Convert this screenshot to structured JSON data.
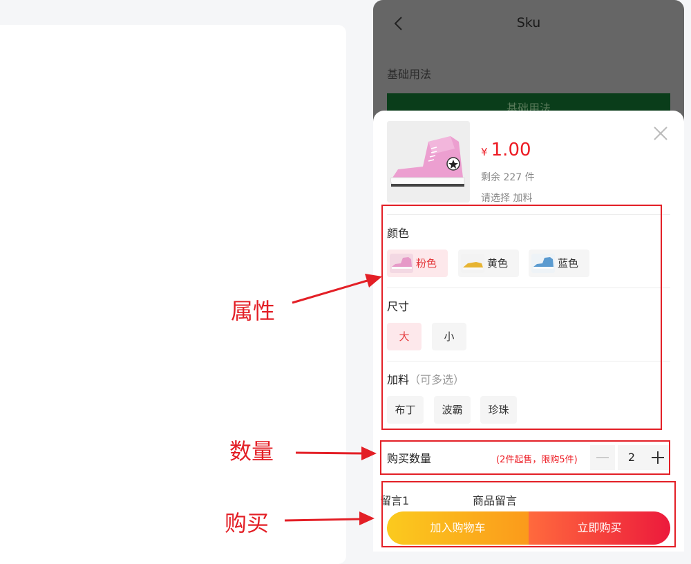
{
  "nav": {
    "title": "Sku"
  },
  "section": {
    "label": "基础用法",
    "button_label": "基础用法"
  },
  "product": {
    "currency": "¥",
    "price": "1.00",
    "stock": "剩余 227 件",
    "hint": "请选择 加料",
    "colors": {
      "shoe_main": "#ec9fd0",
      "accent": "#ed1c24"
    }
  },
  "groups": [
    {
      "title": "颜色",
      "subtitle": "",
      "options": [
        {
          "label": "粉色",
          "selected": true,
          "thumb_color": "#e69ac8"
        },
        {
          "label": "黄色",
          "selected": false,
          "thumb_color": "#e7b432"
        },
        {
          "label": "蓝色",
          "selected": false,
          "thumb_color": "#5b9bd0"
        }
      ]
    },
    {
      "title": "尺寸",
      "subtitle": "",
      "options": [
        {
          "label": "大",
          "selected": true
        },
        {
          "label": "小",
          "selected": false
        }
      ]
    },
    {
      "title": "加料",
      "subtitle": "（可多选）",
      "options": [
        {
          "label": "布丁",
          "selected": false
        },
        {
          "label": "波霸",
          "selected": false
        },
        {
          "label": "珍珠",
          "selected": false
        }
      ]
    }
  ],
  "quantity": {
    "label": "购买数量",
    "limit": "(2件起售，限购5件)",
    "value": "2"
  },
  "message": {
    "label": "留言1",
    "value": "商品留言"
  },
  "actions": {
    "cart": "加入购物车",
    "buy": "立即购买"
  },
  "annotations": {
    "attributes": "属性",
    "quantity": "数量",
    "purchase": "购买"
  }
}
